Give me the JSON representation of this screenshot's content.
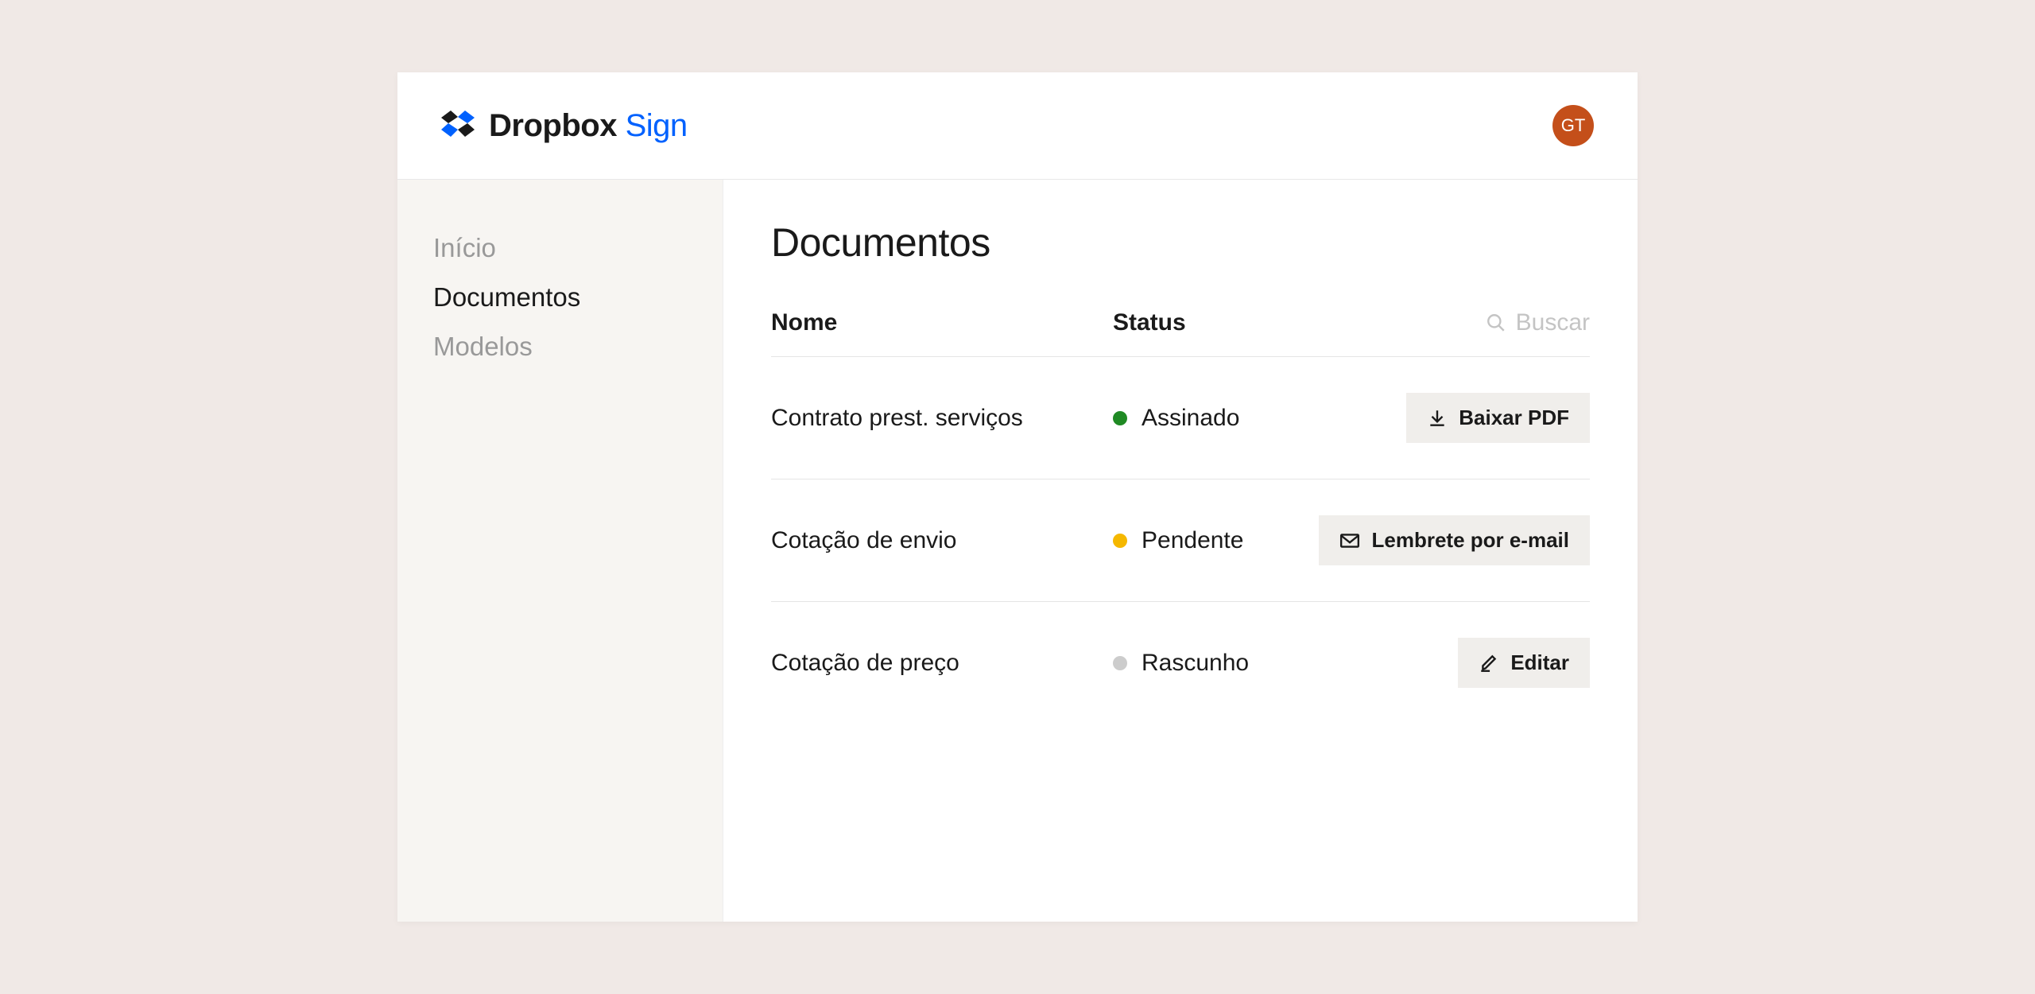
{
  "header": {
    "brand_primary": "Dropbox",
    "brand_secondary": "Sign",
    "avatar_initials": "GT",
    "colors": {
      "brand_blue": "#0061fe",
      "avatar_bg": "#c44f1a"
    }
  },
  "sidebar": {
    "items": [
      {
        "label": "Início",
        "active": false
      },
      {
        "label": "Documentos",
        "active": true
      },
      {
        "label": "Modelos",
        "active": false
      }
    ]
  },
  "main": {
    "title": "Documentos",
    "columns": {
      "name": "Nome",
      "status": "Status"
    },
    "search": {
      "placeholder": "Buscar"
    },
    "rows": [
      {
        "name": "Contrato prest. serviços",
        "status": "Assinado",
        "status_color": "#1f8a24",
        "action": "Baixar PDF",
        "action_icon": "download-icon"
      },
      {
        "name": "Cotação de envio",
        "status": "Pendente",
        "status_color": "#f5b800",
        "action": "Lembrete por e-mail",
        "action_icon": "mail-icon"
      },
      {
        "name": "Cotação de preço",
        "status": "Rascunho",
        "status_color": "#cccccc",
        "action": "Editar",
        "action_icon": "edit-icon"
      }
    ]
  }
}
